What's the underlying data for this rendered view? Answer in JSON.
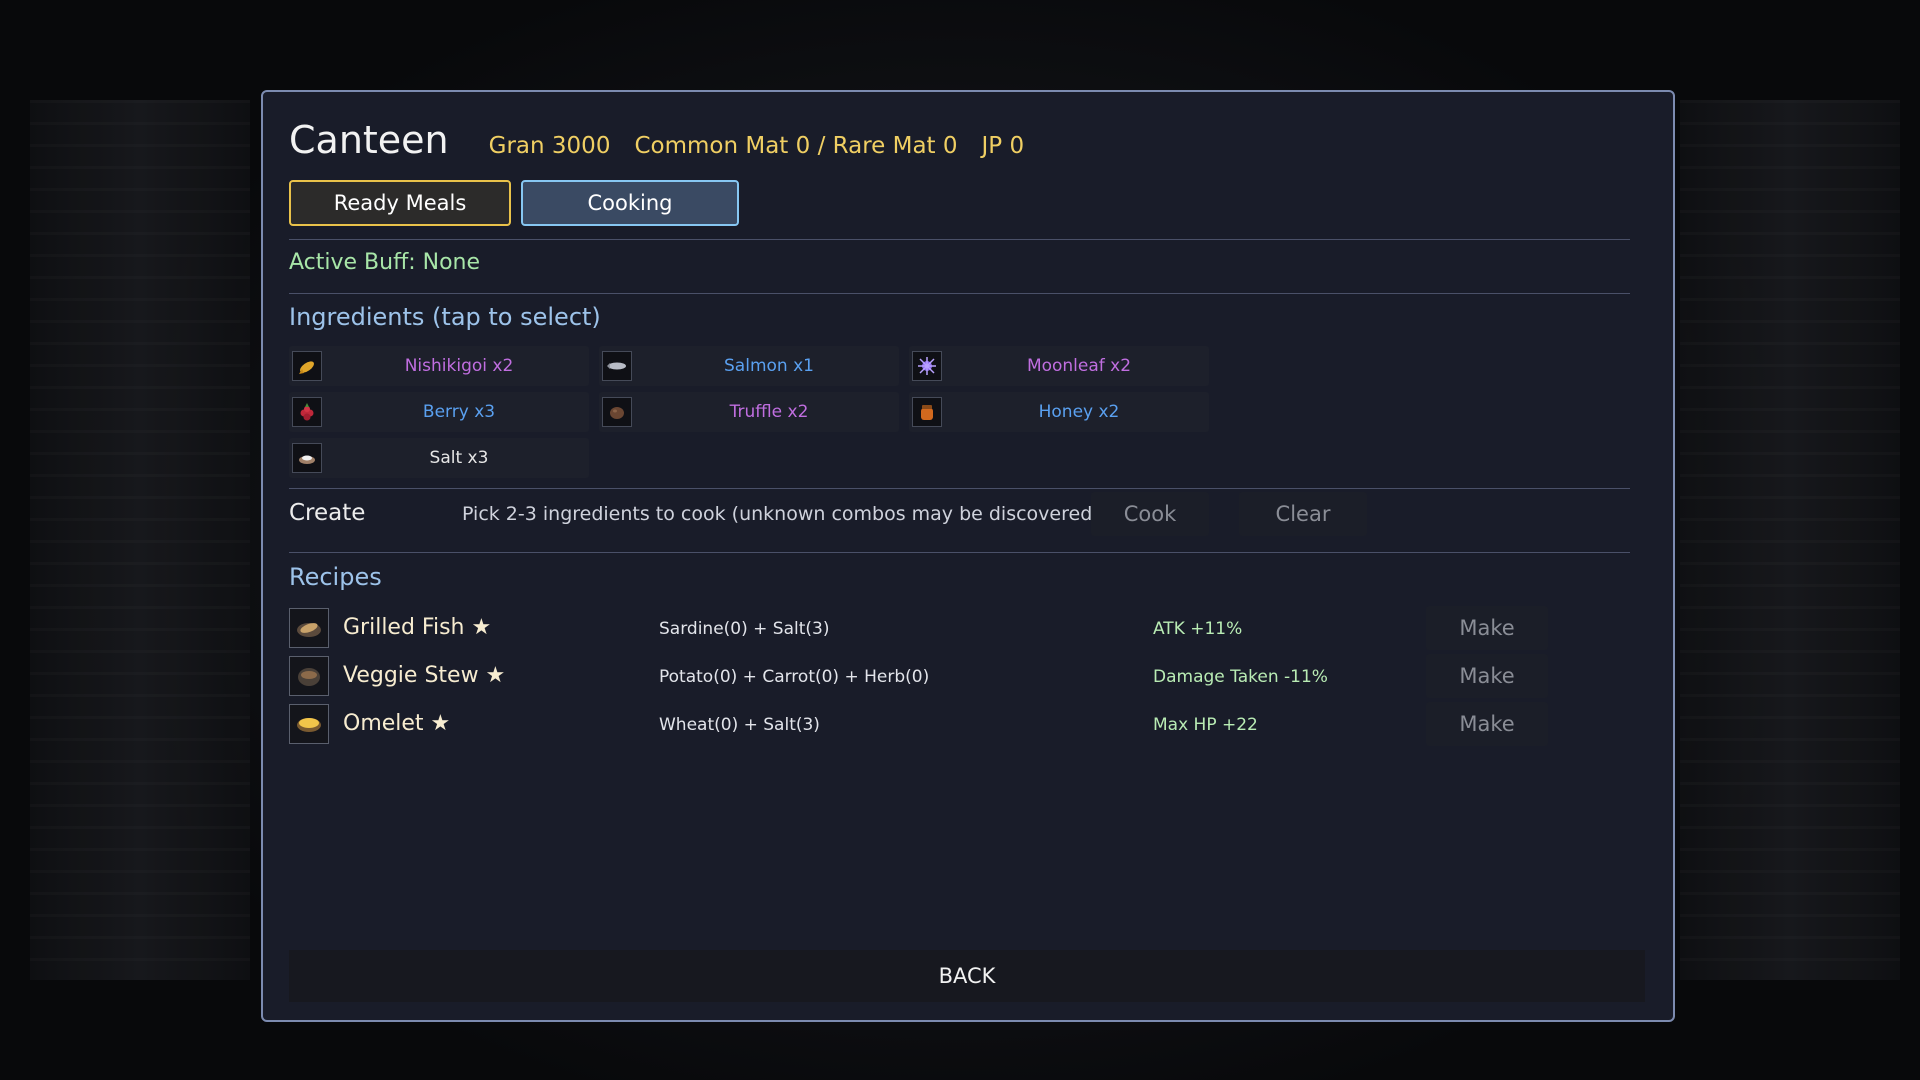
{
  "header": {
    "title": "Canteen",
    "gran": "Gran 3000",
    "materials": "Common Mat 0 / Rare Mat 0",
    "jp": "JP 0"
  },
  "tabs": [
    {
      "label": "Ready Meals"
    },
    {
      "label": "Cooking"
    }
  ],
  "buff": "Active Buff: None",
  "ingredients_title": "Ingredients (tap to select)",
  "ingredients": [
    {
      "label": "Nishikigoi x2",
      "color": "#c06ee0",
      "icon": "fish-icon"
    },
    {
      "label": "Salmon x1",
      "color": "#5aa0f0",
      "icon": "fish-icon"
    },
    {
      "label": "Moonleaf x2",
      "color": "#c06ee0",
      "icon": "leaf-icon"
    },
    {
      "label": "Berry x3",
      "color": "#5aa0f0",
      "icon": "berry-icon"
    },
    {
      "label": "Truffle x2",
      "color": "#c06ee0",
      "icon": "truffle-icon"
    },
    {
      "label": "Honey x2",
      "color": "#5aa0f0",
      "icon": "honey-icon"
    },
    {
      "label": "Salt x3",
      "color": "#e6e6e6",
      "icon": "salt-icon"
    }
  ],
  "create": {
    "label": "Create",
    "hint": "Pick 2-3 ingredients to cook (unknown combos may be discovered)",
    "cook_label": "Cook",
    "clear_label": "Clear"
  },
  "recipes_title": "Recipes",
  "recipes": [
    {
      "name": "Grilled Fish ★",
      "formula": "Sardine(0) + Salt(3)",
      "effect": "ATK +11%",
      "make_label": "Make",
      "icon": "grilled-fish-icon"
    },
    {
      "name": "Veggie Stew ★",
      "formula": "Potato(0) + Carrot(0) + Herb(0)",
      "effect": "Damage Taken -11%",
      "make_label": "Make",
      "icon": "stew-icon"
    },
    {
      "name": "Omelet ★",
      "formula": "Wheat(0) + Salt(3)",
      "effect": "Max HP +22",
      "make_label": "Make",
      "icon": "omelet-icon"
    }
  ],
  "back_label": "BACK"
}
